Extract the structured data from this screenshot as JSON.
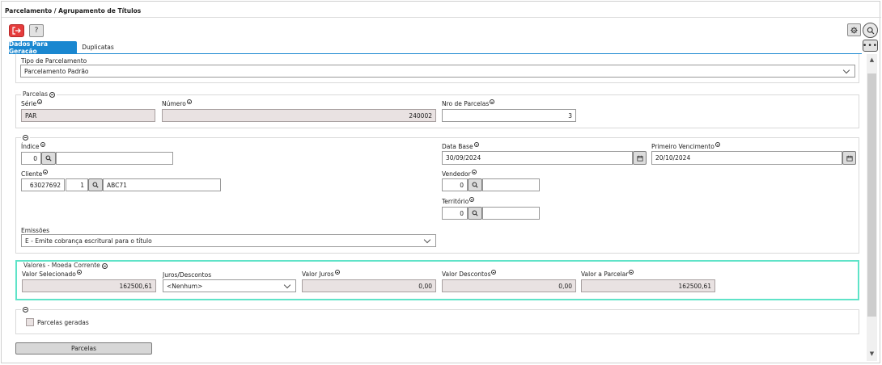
{
  "window": {
    "title": "Parcelamento / Agrupamento de Títulos"
  },
  "toolbar": {
    "help_label": "?"
  },
  "tabs": [
    {
      "label": "Dados Para Geração",
      "active": true
    },
    {
      "label": "Duplicatas",
      "active": false
    }
  ],
  "tipo_parcelamento": {
    "label": "Tipo de Parcelamento",
    "value": "Parcelamento Padrão"
  },
  "parcelas": {
    "legend": "Parcelas",
    "serie": {
      "label": "Série",
      "value": "PAR"
    },
    "numero": {
      "label": "Número",
      "value": "240002"
    },
    "nro_parcelas": {
      "label": "Nro de Parcelas",
      "value": "3"
    }
  },
  "detalhes": {
    "indice": {
      "label": "Índice",
      "value": "0"
    },
    "data_base": {
      "label": "Data Base",
      "value": "30/09/2024"
    },
    "primeiro_vencimento": {
      "label": "Primeiro Vencimento",
      "value": "20/10/2024"
    },
    "cliente": {
      "label": "Cliente",
      "code": "63027692",
      "seq": "1",
      "name": "ABC71"
    },
    "vendedor": {
      "label": "Vendedor",
      "value": "0"
    },
    "territorio": {
      "label": "Território",
      "value": "0"
    },
    "emissoes": {
      "label": "Emissões",
      "value": "E - Emite cobrança escritural para o título"
    }
  },
  "valores": {
    "legend": "Valores - Moeda Corrente",
    "valor_selecionado": {
      "label": "Valor Selecionado",
      "value": "162500,61"
    },
    "juros_descontos": {
      "label": "Juros/Descontos",
      "value": "<Nenhum>"
    },
    "valor_juros": {
      "label": "Valor Juros",
      "value": "0,00"
    },
    "valor_descontos": {
      "label": "Valor Descontos",
      "value": "0,00"
    },
    "valor_a_parcelar": {
      "label": "Valor a Parcelar",
      "value": "162500,61"
    }
  },
  "geradas": {
    "checkbox_label": "Parcelas geradas"
  },
  "actions": {
    "parcelas_button": "Parcelas"
  },
  "colors": {
    "accent": "#1a87d0",
    "exit": "#e53c3c",
    "highlight": "#5fe3c8",
    "readonly": "#e9e2e2"
  }
}
